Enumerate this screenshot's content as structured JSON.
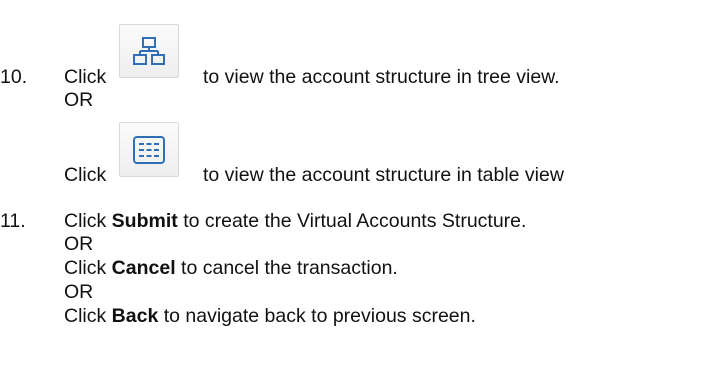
{
  "step10": {
    "number": "10.",
    "click": "Click",
    "tree_desc": "to view the account structure in tree view.",
    "or": "OR",
    "click2": "Click",
    "table_desc": "to view the account structure in table view",
    "tree_icon": "tree-view-icon",
    "table_icon": "table-view-icon",
    "icon_color": "#2f6fb7"
  },
  "step11": {
    "number": "11.",
    "click1": "Click",
    "submit": "Submit",
    "submit_desc": "to create the Virtual Accounts Structure.",
    "or1": "OR",
    "click2": "Click",
    "cancel": "Cancel",
    "cancel_desc": "to cancel the transaction.",
    "or2": "OR",
    "click3": "Click",
    "back": "Back",
    "back_desc": "to navigate back to previous screen."
  }
}
